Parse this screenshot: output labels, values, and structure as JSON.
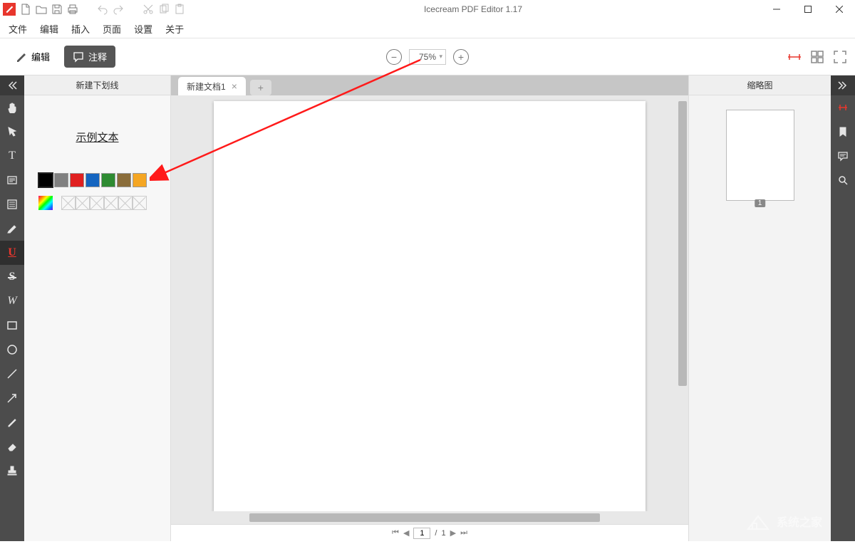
{
  "app_title": "Icecream PDF Editor 1.17",
  "menu": {
    "file": "文件",
    "edit": "编辑",
    "insert": "插入",
    "page": "页面",
    "settings": "设置",
    "about": "关于"
  },
  "mode": {
    "edit": "编辑",
    "annotate": "注释"
  },
  "zoom": {
    "value": "75%"
  },
  "left_panel": {
    "title": "新建下划线",
    "sample": "示例文本"
  },
  "swatches": [
    "#000000",
    "#808080",
    "#e02020",
    "#1565c0",
    "#2e8b32",
    "#8a6d3b",
    "#f5a623"
  ],
  "tabs": {
    "active": "新建文档1"
  },
  "right_panel": {
    "title": "缩略图",
    "thumb_page": "1"
  },
  "pagenav": {
    "current": "1",
    "total": "1"
  },
  "watermark_text": "系统之家"
}
